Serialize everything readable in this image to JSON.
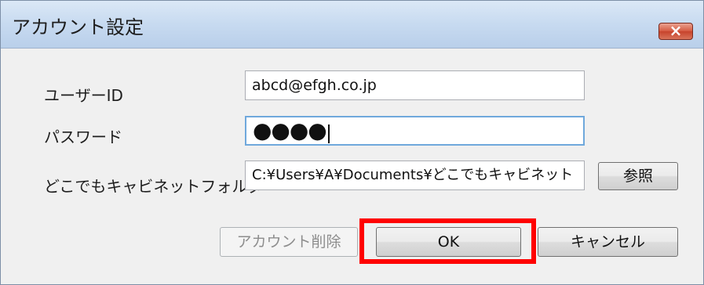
{
  "window": {
    "title": "アカウント設定",
    "close_label": "×"
  },
  "form": {
    "user_id_label": "ユーザーID",
    "user_id_value": "abcd@efgh.co.jp",
    "password_label": "パスワード",
    "password_value": "●●●●",
    "folder_label": "どこでもキャビネットフォルダ",
    "folder_value": "C:¥Users¥A¥Documents¥どこでもキャビネット",
    "browse_label": "参照"
  },
  "buttons": {
    "delete_label": "アカウント削除",
    "ok_label": "OK",
    "cancel_label": "キャンセル"
  },
  "colors": {
    "highlight": "#ff0000",
    "title_gradient": "#c7daf0",
    "close": "#c7432c"
  }
}
